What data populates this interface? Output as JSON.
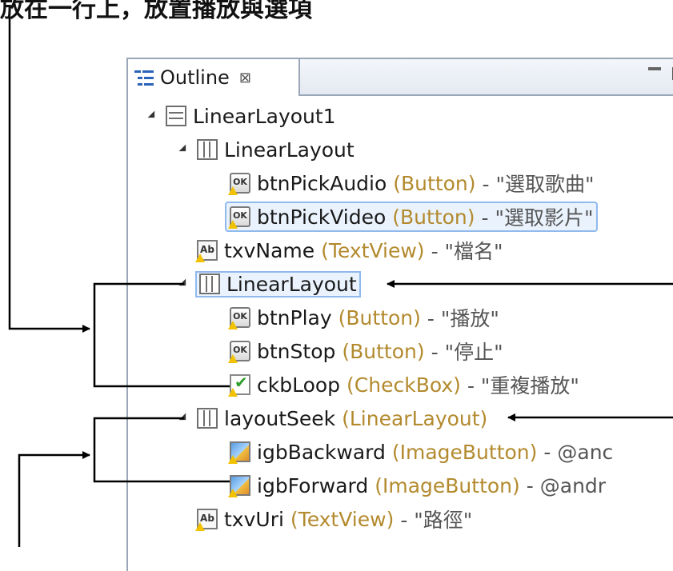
{
  "caption": "放在一行上，放置播放與選項",
  "outline_view": {
    "tab_title": "Outline",
    "tab_close": "⊠",
    "tree": [
      {
        "label": "LinearLayout1",
        "type": "",
        "desc": "",
        "icon": "linear-layout-horizontal-icon"
      },
      {
        "label": "LinearLayout",
        "type": "",
        "desc": "",
        "icon": "linear-layout-vertical-icon"
      },
      {
        "label": "btnPickAudio",
        "type": "(Button)",
        "desc": "- \"選取歌曲\"",
        "icon": "button-warning-icon"
      },
      {
        "label": "btnPickVideo",
        "type": "(Button)",
        "desc": "- \"選取影片\"",
        "icon": "button-warning-icon"
      },
      {
        "label": "txvName",
        "type": "(TextView)",
        "desc": "- \"檔名\"",
        "icon": "textview-warning-icon"
      },
      {
        "label": "LinearLayout",
        "type": "",
        "desc": "",
        "icon": "linear-layout-vertical-icon"
      },
      {
        "label": "btnPlay",
        "type": "(Button)",
        "desc": "- \"播放\"",
        "icon": "button-warning-icon"
      },
      {
        "label": "btnStop",
        "type": "(Button)",
        "desc": "- \"停止\"",
        "icon": "button-warning-icon"
      },
      {
        "label": "ckbLoop",
        "type": "(CheckBox)",
        "desc": "- \"重複播放\"",
        "icon": "checkbox-warning-icon"
      },
      {
        "label": "layoutSeek",
        "type": "(LinearLayout)",
        "desc": "",
        "icon": "linear-layout-vertical-icon"
      },
      {
        "label": "igbBackward",
        "type": "(ImageButton)",
        "desc": "- @anc",
        "icon": "image-button-warning-icon"
      },
      {
        "label": "igbForward",
        "type": "(ImageButton)",
        "desc": "- @andr",
        "icon": "image-button-warning-icon"
      },
      {
        "label": "txvUri",
        "type": "(TextView)",
        "desc": "- \"路徑\"",
        "icon": "textview-warning-icon"
      }
    ]
  },
  "colors": {
    "panel_border": "#9aa7b8",
    "type_text": "#b38a2e",
    "selection": "#90b9ee",
    "arrow": "#000000"
  }
}
